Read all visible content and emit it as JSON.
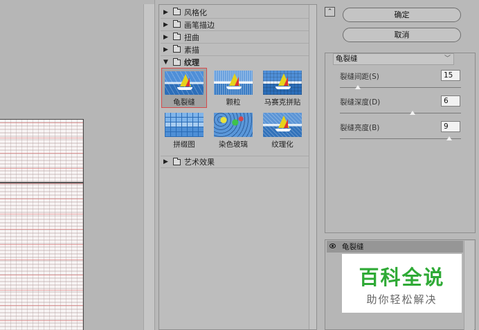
{
  "filter_gallery": {
    "categories": [
      {
        "label": "风格化",
        "state": "collapsed"
      },
      {
        "label": "画笔描边",
        "state": "collapsed"
      },
      {
        "label": "扭曲",
        "state": "collapsed"
      },
      {
        "label": "素描",
        "state": "collapsed"
      },
      {
        "label": "纹理",
        "state": "expanded"
      },
      {
        "label": "艺术效果",
        "state": "collapsed"
      }
    ],
    "texture_filters": [
      {
        "label": "龟裂缝",
        "icon": "boat-crack-thumbnail",
        "selected": true
      },
      {
        "label": "颗粒",
        "icon": "boat-grain-thumbnail",
        "selected": false
      },
      {
        "label": "马赛克拼贴",
        "icon": "boat-mosaic-thumbnail",
        "selected": false
      },
      {
        "label": "拼缀图",
        "icon": "tiles-thumbnail",
        "selected": false
      },
      {
        "label": "染色玻璃",
        "icon": "stained-glass-thumbnail",
        "selected": false
      },
      {
        "label": "纹理化",
        "icon": "boat-texture-thumbnail",
        "selected": false
      }
    ]
  },
  "actions": {
    "ok_label": "确定",
    "cancel_label": "取消",
    "collapse_icon": "collapse-up-icon"
  },
  "settings": {
    "selected_filter": "龟裂缝",
    "params": [
      {
        "label": "裂缝间距(S)",
        "value": "15",
        "level": 0.15
      },
      {
        "label": "裂缝深度(D)",
        "value": "6",
        "level": 0.6
      },
      {
        "label": "裂缝亮度(B)",
        "value": "9",
        "level": 0.9
      }
    ]
  },
  "effect_layers": {
    "layer_name": "龟裂缝",
    "visibility_icon": "eye-icon"
  },
  "watermark": {
    "title": "百科全说",
    "subtitle": "助你轻松解决"
  },
  "colors": {
    "panel_bg": "#b9b9b9",
    "selection_border": "#d64a4a",
    "watermark_green": "#2faa36"
  }
}
